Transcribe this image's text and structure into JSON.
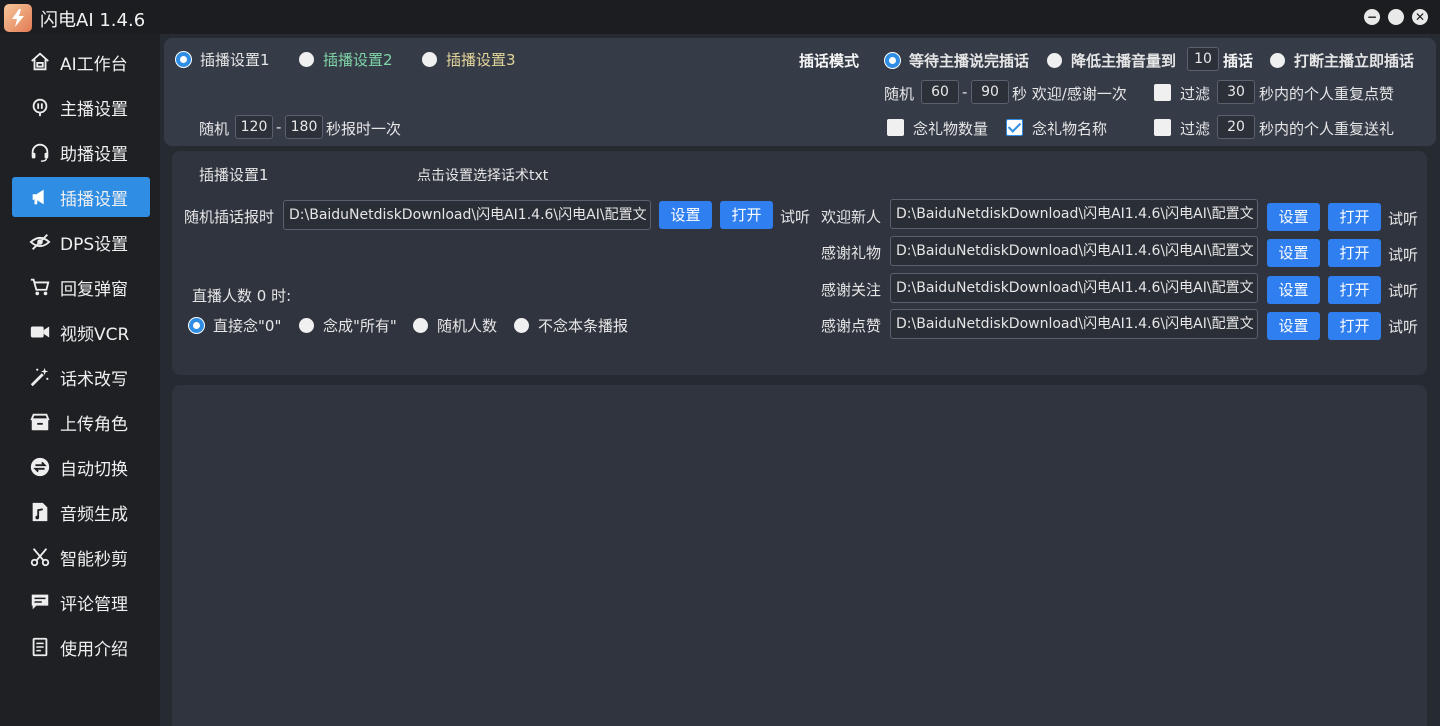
{
  "app": {
    "title": "闪电AI 1.4.6",
    "logo_icon": "lightning-logo"
  },
  "window_buttons": {
    "minimize": "−",
    "maximize": "●",
    "close": "✕"
  },
  "sidebar": {
    "items": [
      {
        "label": "AI工作台",
        "icon": "home-icon"
      },
      {
        "label": "主播设置",
        "icon": "microphone-icon"
      },
      {
        "label": "助播设置",
        "icon": "headset-icon"
      },
      {
        "label": "插播设置",
        "icon": "megaphone-icon",
        "active": true
      },
      {
        "label": "DPS设置",
        "icon": "eye-off-icon"
      },
      {
        "label": "回复弹窗",
        "icon": "cart-icon"
      },
      {
        "label": "视频VCR",
        "icon": "video-camera-icon"
      },
      {
        "label": "话术改写",
        "icon": "magic-wand-icon"
      },
      {
        "label": "上传角色",
        "icon": "inbox-icon"
      },
      {
        "label": "自动切换",
        "icon": "swap-icon"
      },
      {
        "label": "音频生成",
        "icon": "music-file-icon"
      },
      {
        "label": "智能秒剪",
        "icon": "scissors-icon"
      },
      {
        "label": "评论管理",
        "icon": "comment-icon"
      },
      {
        "label": "使用介绍",
        "icon": "document-icon"
      }
    ]
  },
  "profiles": {
    "tab1": "插播设置1",
    "tab2": "插播设置2",
    "tab3": "插播设置3",
    "tab2_color": "#7fd4a6",
    "tab3_color": "#e3d59a"
  },
  "report": {
    "prefix": "随机",
    "min": "120",
    "dash": "-",
    "max": "180",
    "suffix": "秒报时一次"
  },
  "interrupt": {
    "label": "插话模式",
    "opt1": "等待主播说完插话",
    "opt2_prefix": "降低主播音量到",
    "opt2_value": "10",
    "opt2_suffix": "插话",
    "opt3": "打断主播立即插话"
  },
  "welcome": {
    "prefix": "随机",
    "min": "60",
    "dash": "-",
    "max": "90",
    "suffix": "秒 欢迎/感谢一次"
  },
  "filter_like": {
    "label": "过滤",
    "value": "30",
    "suffix": "秒内的个人重复点赞"
  },
  "filter_gift": {
    "label": "过滤",
    "value": "20",
    "suffix": "秒内的个人重复送礼"
  },
  "gift_options": {
    "count": "念礼物数量",
    "name": "念礼物名称"
  },
  "section": {
    "title": "插播设置1",
    "hint": "点击设置选择话术txt",
    "random_label": "随机插话报时",
    "random_path": "D:\\BaiduNetdiskDownload\\闪电AI1.4.6\\闪电AI\\配置文",
    "set": "设置",
    "open": "打开",
    "listen": "试听"
  },
  "rows": [
    {
      "label": "欢迎新人",
      "path": "D:\\BaiduNetdiskDownload\\闪电AI1.4.6\\闪电AI\\配置文"
    },
    {
      "label": "感谢礼物",
      "path": "D:\\BaiduNetdiskDownload\\闪电AI1.4.6\\闪电AI\\配置文"
    },
    {
      "label": "感谢关注",
      "path": "D:\\BaiduNetdiskDownload\\闪电AI1.4.6\\闪电AI\\配置文"
    },
    {
      "label": "感谢点赞",
      "path": "D:\\BaiduNetdiskDownload\\闪电AI1.4.6\\闪电AI\\配置文"
    }
  ],
  "viewers": {
    "label": "直播人数 0 时:",
    "opt1": "直接念\"0\"",
    "opt2": "念成\"所有\"",
    "opt3": "随机人数",
    "opt4": "不念本条播报"
  },
  "colors": {
    "accent": "#2f8de4",
    "button": "#2f7ff0",
    "panel": "#363b48",
    "background": "#1e2024"
  }
}
